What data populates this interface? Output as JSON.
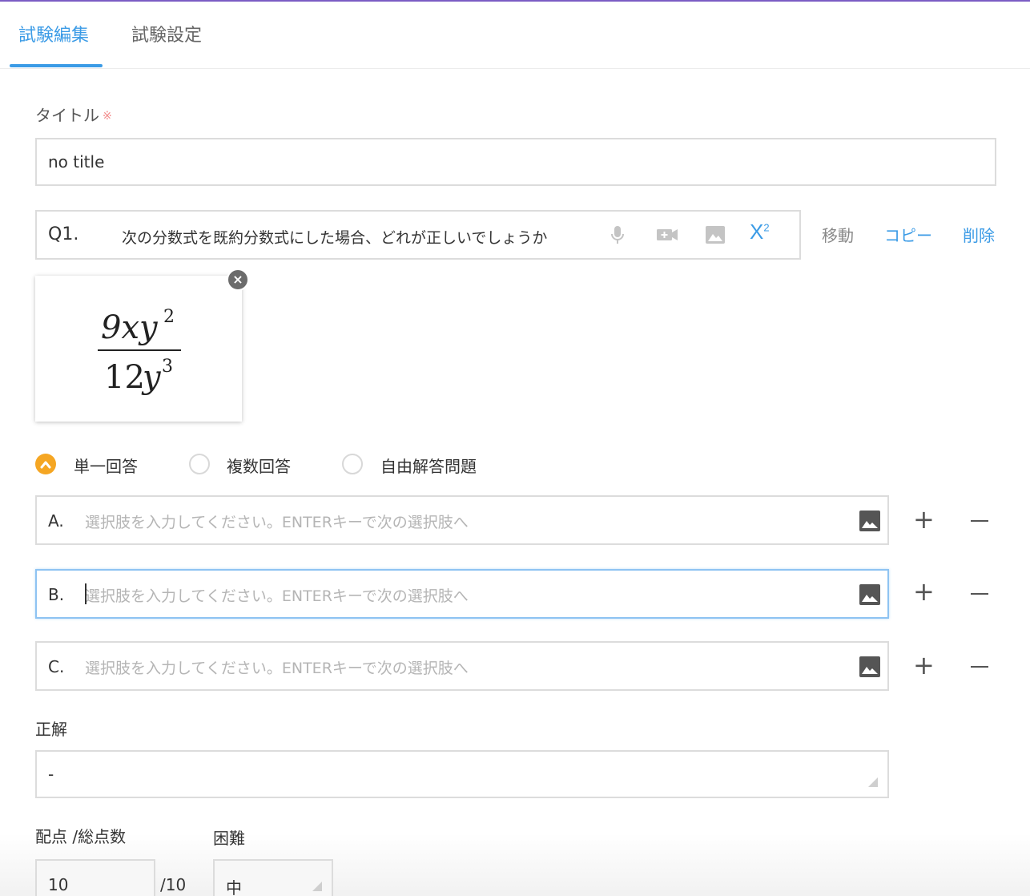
{
  "tabs": [
    {
      "label": "試験編集",
      "active": true
    },
    {
      "label": "試験設定",
      "active": false
    }
  ],
  "title_field": {
    "label": "タイトル",
    "required_mark": "※",
    "value": "no title"
  },
  "question": {
    "number": "Q1.",
    "text": "次の分数式を既約分数式にした場合、どれが正しいでしょうか",
    "tools": [
      "microphone-icon",
      "video-icon",
      "image-icon",
      "superscript-icon"
    ],
    "superscript_label": "X²",
    "actions": {
      "move": "移動",
      "copy": "コピー",
      "delete": "削除"
    },
    "image": {
      "numerator": "9xy²",
      "denominator": "12y³"
    }
  },
  "answer_types": [
    {
      "label": "単一回答",
      "selected": true
    },
    {
      "label": "複数回答",
      "selected": false
    },
    {
      "label": "自由解答問題",
      "selected": false
    }
  ],
  "options": [
    {
      "letter": "A.",
      "placeholder": "選択肢を入力してください。ENTERキーで次の選択肢へ",
      "focused": false
    },
    {
      "letter": "B.",
      "placeholder": "選択肢を入力してください。ENTERキーで次の選択肢へ",
      "focused": true
    },
    {
      "letter": "C.",
      "placeholder": "選択肢を入力してください。ENTERキーで次の選択肢へ",
      "focused": false
    }
  ],
  "correct_answer": {
    "label": "正解",
    "value": "-"
  },
  "score": {
    "label": "配点 /総点数",
    "value": "10",
    "total": "/10"
  },
  "difficulty": {
    "label": "困難",
    "value": "中"
  },
  "colors": {
    "accent": "#3b9be6",
    "radio_selected": "#f5a623",
    "top_border": "#7b5cc4",
    "required": "#f28b8b"
  }
}
